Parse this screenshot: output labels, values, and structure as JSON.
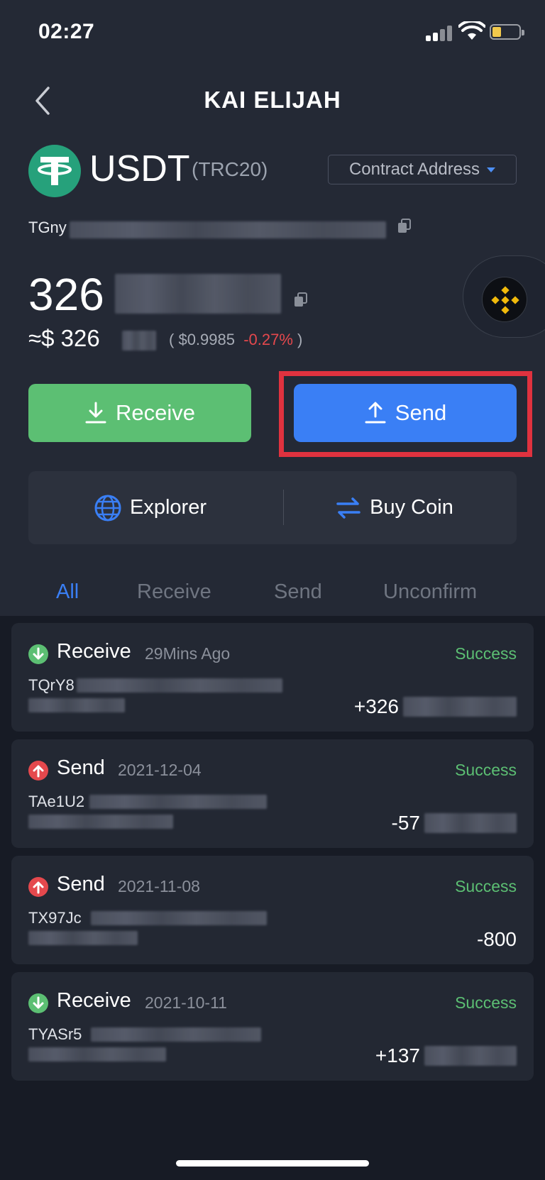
{
  "status_bar": {
    "time": "02:27"
  },
  "nav": {
    "title": "KAI ELIJAH"
  },
  "token": {
    "symbol": "USDT",
    "network": "(TRC20)",
    "contract_label": "Contract Address",
    "address_prefix": "TGny"
  },
  "balance": {
    "amount_prefix": "326",
    "fiat_prefix": "≈$ 326",
    "price": "$0.9985",
    "change": "-0.27%"
  },
  "actions": {
    "receive": "Receive",
    "send": "Send"
  },
  "links": {
    "explorer": "Explorer",
    "buy": "Buy Coin"
  },
  "tabs": [
    "All",
    "Receive",
    "Send",
    "Unconfirm"
  ],
  "transactions": [
    {
      "type": "Receive",
      "date": "29Mins Ago",
      "status": "Success",
      "address": "TQrY8",
      "amount": "+326"
    },
    {
      "type": "Send",
      "date": "2021-12-04",
      "status": "Success",
      "address": "TAe1U2",
      "amount": "-57"
    },
    {
      "type": "Send",
      "date": "2021-11-08",
      "status": "Success",
      "address": "TX97Jc",
      "amount": "-800"
    },
    {
      "type": "Receive",
      "date": "2021-10-11",
      "status": "Success",
      "address": "TYASr5",
      "amount": "+137"
    }
  ],
  "colors": {
    "background": "#171b25",
    "header": "#242935",
    "receive_green": "#5cbf73",
    "send_blue": "#3a7ff5",
    "negative_red": "#e5484d",
    "highlight_red": "#e0323f",
    "tether_green": "#26a17b"
  }
}
